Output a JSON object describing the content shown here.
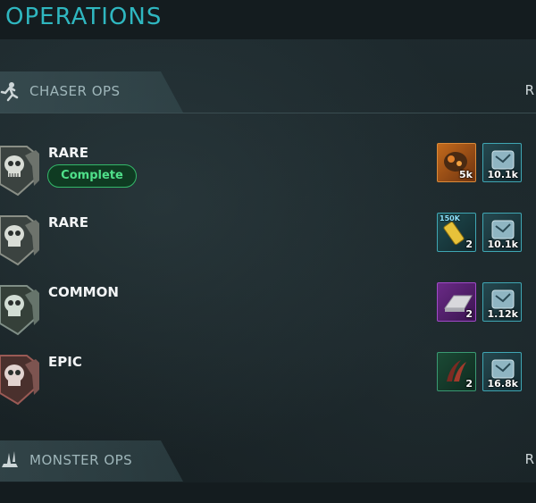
{
  "header": {
    "title": "OPERATIONS"
  },
  "sections": {
    "chaser": {
      "label": "CHASER OPS",
      "right_cut": "R",
      "icon": "chaser-runner-icon"
    },
    "monster": {
      "label": "MONSTER OPS",
      "right_cut": "R",
      "icon": "monster-claw-icon"
    }
  },
  "ops": [
    {
      "rarity": "RARE",
      "status": "Complete",
      "shield_color": "#8a8f86",
      "rewards": [
        {
          "icon": "resource-ore-icon",
          "qty": "5k",
          "tag": ""
        },
        {
          "icon": "intel-crate-icon",
          "qty": "10.1k",
          "tag": ""
        }
      ]
    },
    {
      "rarity": "RARE",
      "status": "",
      "shield_color": "#8a8f86",
      "rewards": [
        {
          "icon": "energy-battery-icon",
          "qty": "2",
          "tag": "150K"
        },
        {
          "icon": "intel-crate-icon",
          "qty": "10.1k",
          "tag": ""
        }
      ]
    },
    {
      "rarity": "COMMON",
      "status": "",
      "shield_color": "#7f8e86",
      "rewards": [
        {
          "icon": "metal-ingot-icon",
          "qty": "2",
          "tag": ""
        },
        {
          "icon": "intel-crate-icon",
          "qty": "1.12k",
          "tag": ""
        }
      ]
    },
    {
      "rarity": "EPIC",
      "status": "",
      "shield_color": "#9a5a55",
      "rewards": [
        {
          "icon": "claw-fragment-icon",
          "qty": "2",
          "tag": ""
        },
        {
          "icon": "intel-crate-icon",
          "qty": "16.8k",
          "tag": ""
        }
      ]
    }
  ],
  "colors": {
    "accent": "#2fb7c0",
    "complete": "#4fe08a",
    "rare_border": "#3fa6b3",
    "epic_tint": "#9a5a55"
  }
}
